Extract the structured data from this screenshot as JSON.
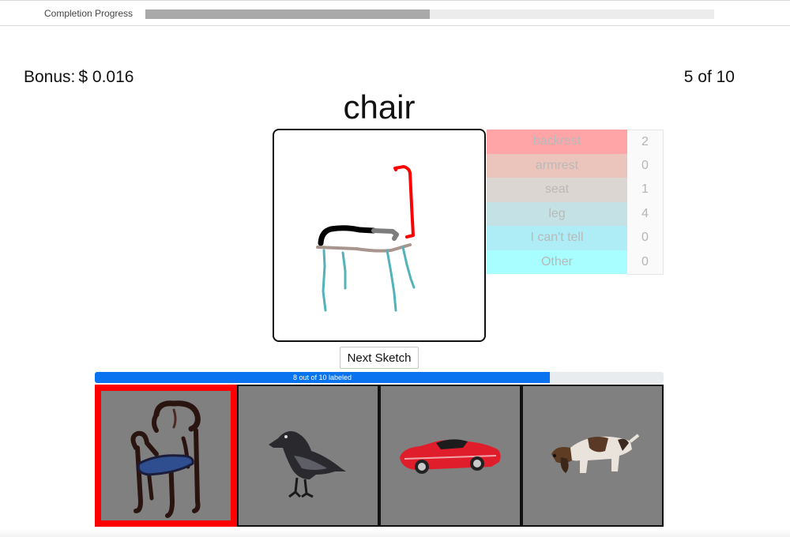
{
  "progress": {
    "label": "Completion Progress",
    "fraction": 0.5
  },
  "bonus": {
    "label": "Bonus:",
    "amount": "$ 0.016"
  },
  "counter": "5 of 10",
  "category": "chair",
  "parts": [
    {
      "name": "backrest",
      "count": "2",
      "color": "#ffa5a8"
    },
    {
      "name": "armrest",
      "count": "0",
      "color": "#ebc5bc"
    },
    {
      "name": "seat",
      "count": "1",
      "color": "#dcd6d3"
    },
    {
      "name": "leg",
      "count": "4",
      "color": "#c4e2e5"
    },
    {
      "name": "I can't tell",
      "count": "0",
      "color": "#aeedf6"
    },
    {
      "name": "Other",
      "count": "0",
      "color": "#a8fefe"
    }
  ],
  "sketch_stroke_colors": {
    "backrest": "#ff0000",
    "seat_front": "#000000",
    "seat_back": "#7d7d7d",
    "seat_edge": "#a8958d",
    "leg": "#52b3ba"
  },
  "next_button": "Next Sketch",
  "labeled_progress": {
    "text": "8 out of 10 labeled",
    "fraction": 0.8
  },
  "thumbnails": [
    {
      "name": "chair-thumbnail",
      "icon": "chair-3d-icon",
      "selected": true
    },
    {
      "name": "crow-thumbnail",
      "icon": "crow-3d-icon",
      "selected": false
    },
    {
      "name": "car-thumbnail",
      "icon": "sports-car-3d-icon",
      "selected": false
    },
    {
      "name": "dog-thumbnail",
      "icon": "dog-3d-icon",
      "selected": false
    }
  ],
  "colors": {
    "selected_border": "#ff0000",
    "thumb_background": "#808080",
    "labeled_bar": "#0a74f0"
  }
}
